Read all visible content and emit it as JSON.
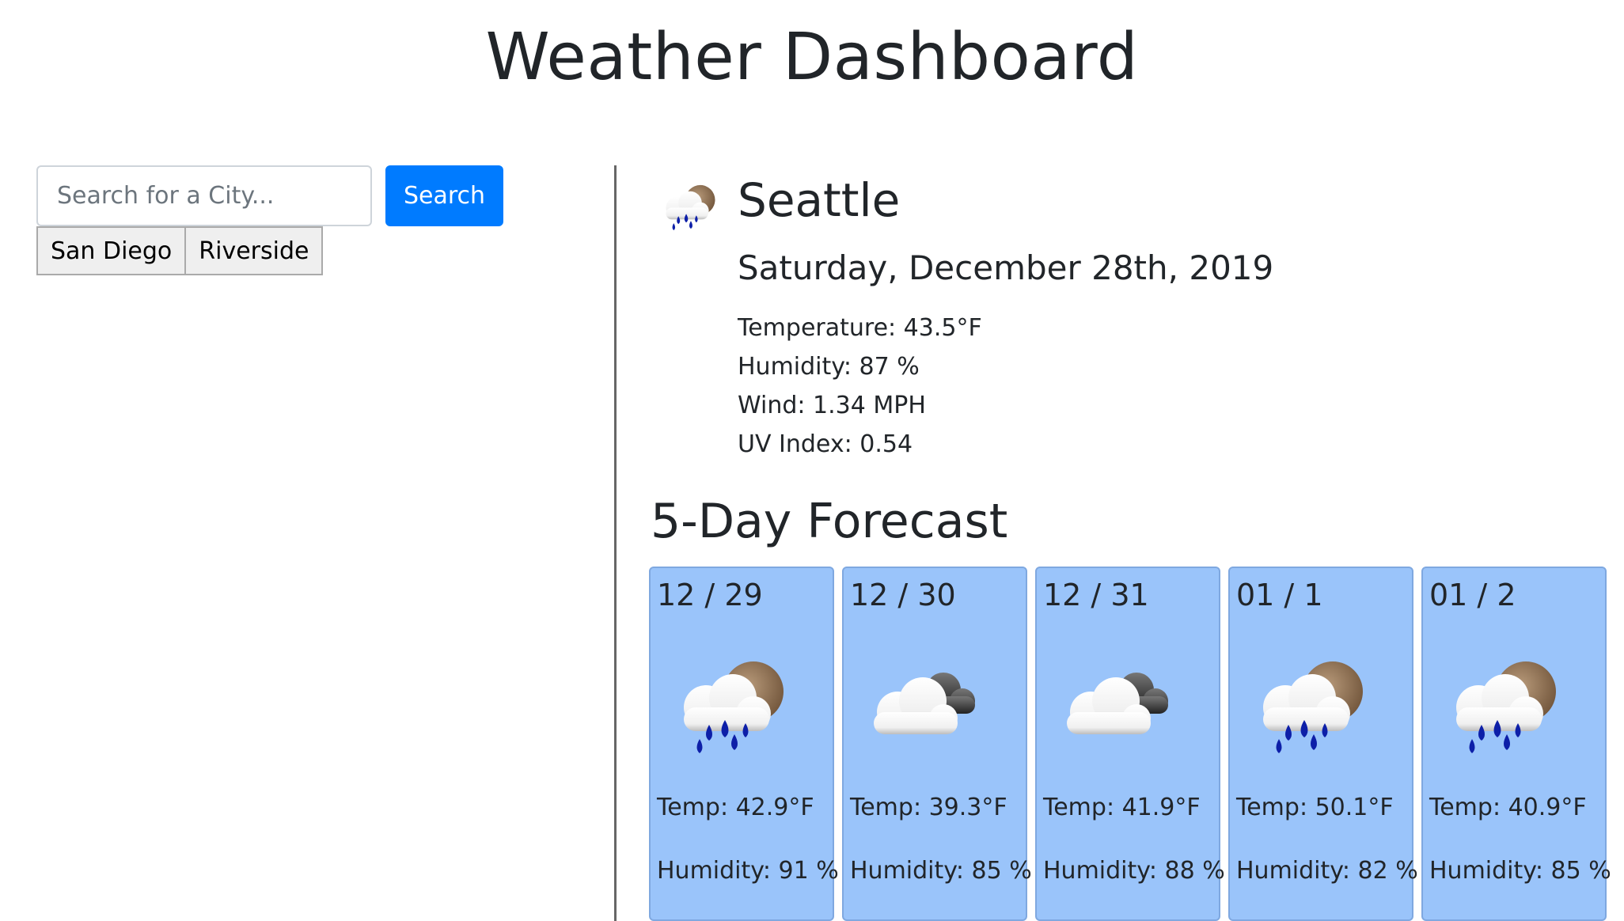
{
  "header": {
    "title": "Weather Dashboard"
  },
  "search": {
    "placeholder": "Search for a City...",
    "button_label": "Search"
  },
  "history": [
    {
      "label": "San Diego"
    },
    {
      "label": "Riverside"
    }
  ],
  "current": {
    "icon": "rain-cloud-sun-icon",
    "city": "Seattle",
    "date": "Saturday, December 28th, 2019",
    "temperature": "Temperature: 43.5°F",
    "humidity": "Humidity: 87 %",
    "wind": "Wind: 1.34 MPH",
    "uv": "UV Index: 0.54"
  },
  "forecast": {
    "title": "5-Day Forecast",
    "days": [
      {
        "date": "12 / 29",
        "icon": "rain-cloud-sun-icon",
        "temp": "Temp: 42.9°F",
        "humidity": "Humidity: 91 %"
      },
      {
        "date": "12 / 30",
        "icon": "cloudy-icon",
        "temp": "Temp: 39.3°F",
        "humidity": "Humidity: 85 %"
      },
      {
        "date": "12 / 31",
        "icon": "cloudy-icon",
        "temp": "Temp: 41.9°F",
        "humidity": "Humidity: 88 %"
      },
      {
        "date": "01 / 1",
        "icon": "rain-cloud-sun-icon",
        "temp": "Temp: 50.1°F",
        "humidity": "Humidity: 82 %"
      },
      {
        "date": "01 / 2",
        "icon": "rain-cloud-sun-icon",
        "temp": "Temp: 40.9°F",
        "humidity": "Humidity: 85 %"
      }
    ]
  },
  "colors": {
    "accent": "#007bff",
    "card_background": "#9ac4fa",
    "card_border": "#7fa8e0",
    "divider": "#666666"
  }
}
